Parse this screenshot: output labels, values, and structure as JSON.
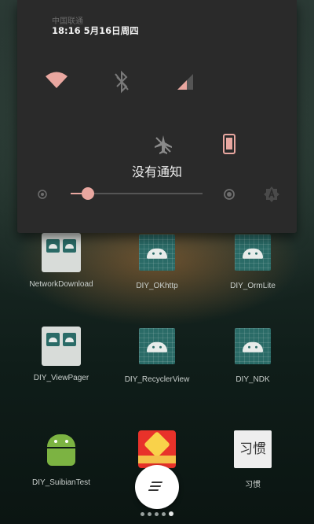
{
  "status_bar": {
    "carrier": "中国联通",
    "time_date": "18:16  5月16日周四"
  },
  "quick_settings": {
    "tiles": [
      {
        "name": "wifi-icon",
        "active": true
      },
      {
        "name": "bluetooth-icon",
        "active": false
      },
      {
        "name": "cellular-signal-icon",
        "active": true
      },
      {
        "name": "airplane-mode-icon",
        "active": false
      },
      {
        "name": "phone-screen-icon",
        "active": true
      }
    ],
    "accent_color": "#e9a7a0"
  },
  "brightness": {
    "level": 0.13
  },
  "notifications": {
    "empty_text": "没有通知"
  },
  "apps": [
    {
      "label": "NetworkDownload",
      "icon": "twin-android-icon"
    },
    {
      "label": "DIY_OKhttp",
      "icon": "android-grid-icon"
    },
    {
      "label": "DIY_OrmLite",
      "icon": "android-grid-icon"
    },
    {
      "label": "DIY_ViewPager",
      "icon": "twin-android-icon"
    },
    {
      "label": "DIY_RecyclerView",
      "icon": "android-grid-icon"
    },
    {
      "label": "DIY_NDK",
      "icon": "android-grid-icon"
    },
    {
      "label": "DIY_SuibianTest",
      "icon": "green-android-icon"
    },
    {
      "label": "",
      "icon": "taobao-icon"
    },
    {
      "label": "习惯",
      "icon": "habit-word-icon",
      "icon_text": "习惯"
    }
  ],
  "page_indicator": {
    "pages": 5,
    "current": 4
  }
}
